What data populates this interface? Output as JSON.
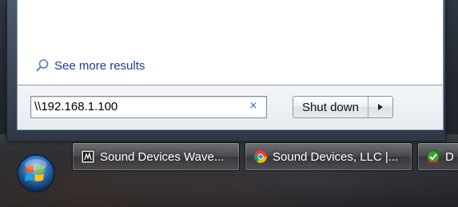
{
  "start_menu": {
    "see_more_results": "See more results",
    "search": {
      "value": "\\\\192.168.1.100",
      "clear_glyph": "×"
    },
    "shutdown": {
      "label": "Shut down",
      "arrow_icon": "triangle-right-icon"
    }
  },
  "taskbar": {
    "start_button_icon": "windows-logo-icon",
    "buttons": [
      {
        "label": "Sound Devices Wave...",
        "icon": "wave-app-icon"
      },
      {
        "label": "Sound Devices, LLC |...",
        "icon": "chrome-icon"
      },
      {
        "label": "D",
        "icon": "green-check-app-icon"
      }
    ]
  },
  "colors": {
    "link_blue": "#1b3f8f",
    "clear_blue": "#3a6fb8",
    "taskbar_text": "#ffffff"
  }
}
